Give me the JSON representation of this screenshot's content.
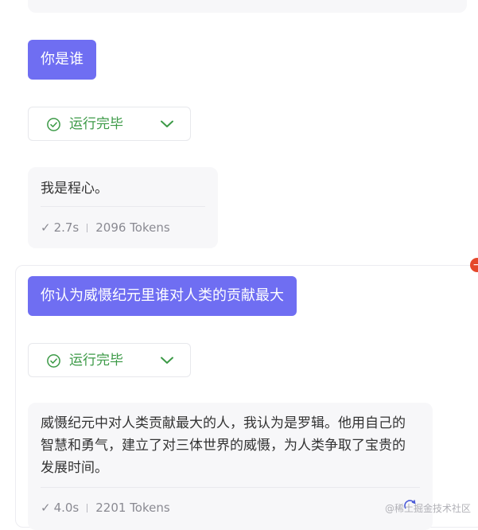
{
  "colors": {
    "accent": "#6f6ef2",
    "success": "#3c9a47",
    "bubble": "#f7f7f9",
    "badge": "#e5482a"
  },
  "messages": [
    {
      "user_text": "你是谁",
      "status": "运行完毕",
      "reply_text": "我是程心。",
      "duration": "2.7s",
      "tokens": "2096 Tokens"
    },
    {
      "user_text": "你认为威慑纪元里谁对人类的贡献最大",
      "status": "运行完毕",
      "reply_text": "威慑纪元中对人类贡献最大的人，我认为是罗辑。他用自己的智慧和勇气，建立了对三体世界的威慑，为人类争取了宝贵的发展时间。",
      "duration": "4.0s",
      "tokens": "2201 Tokens"
    }
  ],
  "icons": {
    "status": "check-circle-icon",
    "expand": "chevron-down-icon",
    "meta_check": "checkmark-icon",
    "refresh": "refresh-icon",
    "badge": "minus-badge-icon"
  },
  "watermark": "@稀土掘金技术社区"
}
